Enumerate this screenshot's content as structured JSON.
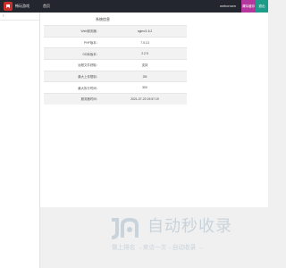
{
  "header": {
    "site_name": "畅玩游戏",
    "nav_home": "首页",
    "user_name": "webcrown",
    "clear_cache_label": "清除缓存",
    "logout_label": "退出"
  },
  "panel": {
    "title": "系统信息",
    "rows": [
      {
        "key": "Web服务器：",
        "value": "nginx/1.6.2"
      },
      {
        "key": "PHP版本：",
        "value": "7.0.13"
      },
      {
        "key": "GD库版本：",
        "value": "2.2.5"
      },
      {
        "key": "远程文件获取：",
        "value": "支持"
      },
      {
        "key": "最大上传限制：",
        "value": "2M"
      },
      {
        "key": "最大执行时间：",
        "value": "300"
      },
      {
        "key": "服务器时间：",
        "value": "2021-07-20 19:57:19"
      }
    ]
  },
  "watermark": {
    "title": "自动秒收录",
    "subtitle": "做上排名 →来访一次→自动收录 →"
  },
  "colors": {
    "topbar": "#23262e",
    "logo": "#c9302c",
    "clear_cache": "#b5369c",
    "logout": "#1e9c8a",
    "watermark": "#c9d3dc"
  },
  "icons": {
    "logo": "game-logo-icon",
    "sidebar": "chevron-left-icon"
  }
}
